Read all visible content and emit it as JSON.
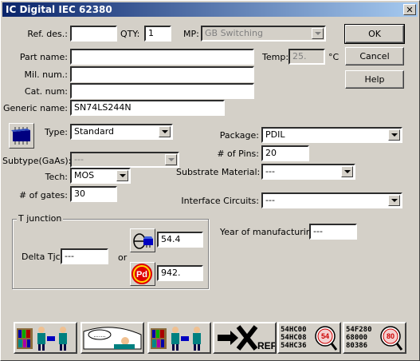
{
  "window": {
    "title": "IC Digital IEC 62380",
    "close_glyph": "✕"
  },
  "buttons": {
    "ok": "OK",
    "cancel": "Cancel",
    "help": "Help"
  },
  "fields": {
    "ref_des": {
      "label": "Ref. des.:",
      "value": ""
    },
    "qty": {
      "label": "QTY:",
      "value": "1"
    },
    "mp": {
      "label": "MP:",
      "value": "GB Switching"
    },
    "part_name": {
      "label": "Part name:",
      "value": ""
    },
    "temp": {
      "label": "Temp:",
      "value": "25.",
      "unit": "°C"
    },
    "mil_num": {
      "label": "Mil. num.:",
      "value": ""
    },
    "cat_num": {
      "label": "Cat. num:",
      "value": ""
    },
    "generic_name": {
      "label": "Generic name:",
      "value": "SN74LS244N"
    },
    "type": {
      "label": "Type:",
      "value": "Standard"
    },
    "subtype": {
      "label": "Subtype(GaAs):",
      "value": "---"
    },
    "tech": {
      "label": "Tech:",
      "value": "MOS"
    },
    "gates": {
      "label": "# of gates:",
      "value": "30"
    },
    "package": {
      "label": "Package:",
      "value": "PDIL"
    },
    "pins": {
      "label": "# of Pins:",
      "value": "20"
    },
    "substrate": {
      "label": "Substrate Material:",
      "value": "---"
    },
    "interface": {
      "label": "Interface Circuits:",
      "value": "---"
    },
    "year": {
      "label": "Year of manufacturing:",
      "value": "---"
    }
  },
  "tjunction": {
    "group_label": "T junction",
    "delta_label": "Delta Tjc:",
    "delta_value": "---",
    "or_label": "or",
    "theta_value": "54.4",
    "pd_value": "942.",
    "pd_icon_text": "Pd"
  },
  "toolbar": {
    "ref_text": "REF",
    "search1_lines": [
      "54HC00",
      "54HC08",
      "54HC36"
    ],
    "search1_badge": "54",
    "search2_lines": [
      "54F280",
      "68000",
      "80386"
    ],
    "search2_badge": "80"
  }
}
